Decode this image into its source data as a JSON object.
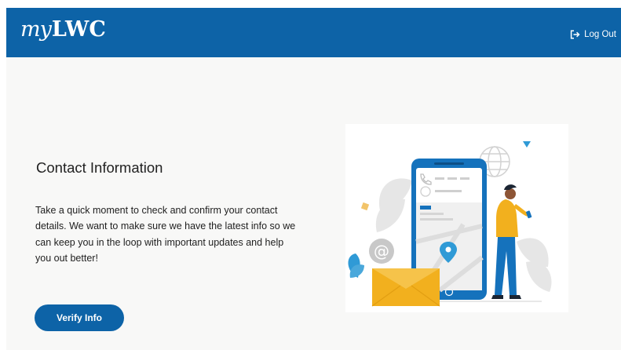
{
  "header": {
    "logo_prefix": "my",
    "logo_main": "LWC",
    "logout_label": "Log Out",
    "logout_icon": "sign-out-icon"
  },
  "main": {
    "title": "Contact Information",
    "description": "Take a quick moment to check and confirm your contact details. We want to make sure we have the latest info so we can keep you in the loop with important updates and help you out better!",
    "verify_label": "Verify Info"
  },
  "illustration": {
    "icons": [
      "phone-icon",
      "globe-icon",
      "at-sign-icon",
      "envelope-icon",
      "map-pin-icon"
    ],
    "label": "person checking contact information on a large phone"
  },
  "colors": {
    "brand_blue": "#0d63a7",
    "page_background": "#f8f8f7",
    "envelope_yellow": "#f2b01e",
    "accent_cyan": "#2f9ad6"
  }
}
